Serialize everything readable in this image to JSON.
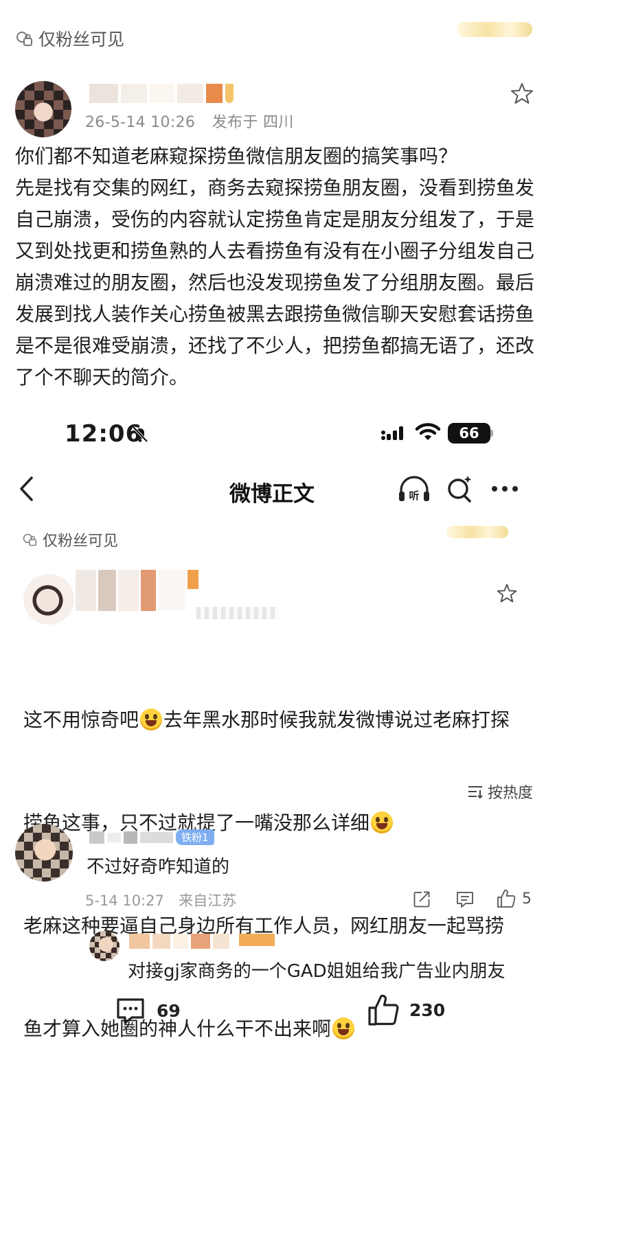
{
  "top_post": {
    "visibility": "仅粉丝可见",
    "timestamp": "26-5-14 10:26",
    "location": "发布于 四川",
    "body": "你们都不知道老麻窥探捞鱼微信朋友圈的搞笑事吗？\n先是找有交集的网红，商务去窥探捞鱼朋友圈，没看到捞鱼发自己崩溃，受伤的内容就认定捞鱼肯定是朋友分组发了，于是又到处找更和捞鱼熟的人去看捞鱼有没有在小圈子分组发自己崩溃难过的朋友圈，然后也没发现捞鱼发了分组朋友圈。最后发展到找人装作关心捞鱼被黑去跟捞鱼微信聊天安慰套话捞鱼是不是很难受崩溃，还找了不少人，把捞鱼都搞无语了，还改了个不聊天的简介。"
  },
  "status_bar": {
    "time": "12:06",
    "battery": "66"
  },
  "nav": {
    "title": "微博正文"
  },
  "repost": {
    "visibility": "仅粉丝可见",
    "line1a": "这不用惊奇吧",
    "line1b": "去年黑水那时候我就发微博说过老麻打探",
    "line2": "捞鱼这事，只不过就提了一嘴没那么详细",
    "line3": "老麻这种要逼自己身边所有工作人员，网红朋友一起骂捞",
    "line4": "鱼才算入她圈的神人什么干不出来啊"
  },
  "sort": {
    "label": "按热度"
  },
  "comment": {
    "badge": "铁粉1",
    "text": "不过好奇咋知道的",
    "time": "5-14 10:27",
    "location": "来自江苏",
    "likes": "5",
    "reply_text": "对接gj家商务的一个GAD姐姐给我广告业内朋友"
  },
  "bottom_bar": {
    "comments": "69",
    "likes": "230"
  },
  "icons": {
    "lock": "lock-icon",
    "star": "star-icon",
    "back": "back-arrow-icon",
    "listen": "headphones-icon",
    "search": "search-icon",
    "more": "more-icon",
    "sort": "sort-icon",
    "share": "share-icon",
    "comment": "comment-icon",
    "like": "thumbs-up-icon"
  },
  "colors": {
    "badge": "#7eaef0",
    "text": "#1e1e1e",
    "meta": "#8a8a8a"
  }
}
